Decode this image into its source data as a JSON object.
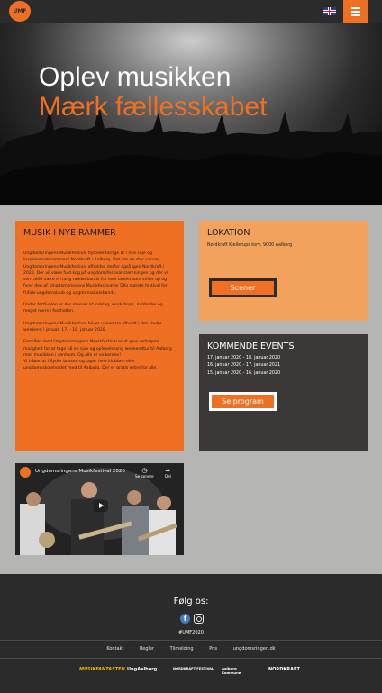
{
  "header": {
    "logo_text": "UMF",
    "language_flag": "uk-flag-icon",
    "menu_icon": "hamburger-menu-icon",
    "accent_color": "#ef7023"
  },
  "hero": {
    "title_line1": "Oplev musikken",
    "title_line2": "Mærk fællesskabet"
  },
  "music_card": {
    "heading": "MUSIK I NYE RAMMER",
    "paragraphs": [
      "Ungdomsringens Musikfestival flyttede forrige år i nye seje og inspirerende rammer i Nordkraft i Aalborg. Det var en stor succes, Ungdomsringens Musikfestival afholdes derfor også igen Nordkraft i 2020. Der vil være fuld kog på ungdomsfestival-stemningen og der vil som altid være en lang række bands fra hele landet som stiller op og fyrer den af. Ungdomsringens Musikfestival er DKs største festival for fritids-ungdomsklub og ungdomsskolebands.",
      "Under festivalen er der masser af indslag, workshops, infoboder og meget mere i festhallen.",
      "Ungdomsringens Musikfestival bliver vanen tro afholdt i den tredje weekend i januar, 17. - 18. januar 2020.",
      "Formålet med Ungdomsringens Musikfestival er at give deltagere mulighed for at tage på en sjov og oplevelsesrig weekendtur til Aalborg med musikken i centrum. Og alle er velkomne!\nVi håber at I flyder bussen og tager hele klubben eller ungdomsskoleholdet med til Aalborg. Der er gratis entre for alle."
    ]
  },
  "location_card": {
    "heading": "LOKATION",
    "address": "Nordkraft Kjellerups torv, 9000 Aalborg",
    "button_label": "Scener"
  },
  "events_card": {
    "heading": "KOMMENDE EVENTS",
    "events": [
      "17. januar 2020 - 18. januar 2020",
      "16. januar 2020 - 17. januar 2021",
      "15. januar 2020 - 16. januar 2020"
    ],
    "button_label": "Se program"
  },
  "video": {
    "title": "Ungdomsringens Musikfestival 2020",
    "watch_later": "Se senere",
    "share": "Del"
  },
  "footer": {
    "follow": "Følg os:",
    "hashtag": "#UMF2020",
    "links": [
      "Kontakt",
      "Regler",
      "Tilmelding",
      "Pris",
      "ungdomsringen.dk"
    ],
    "sponsors": [
      "MUSIKFANTASTEN",
      "UngAalborg",
      "NORDKRAFT FESTIVAL",
      "Aalborg Kommune",
      "NORDKRAFT"
    ]
  }
}
